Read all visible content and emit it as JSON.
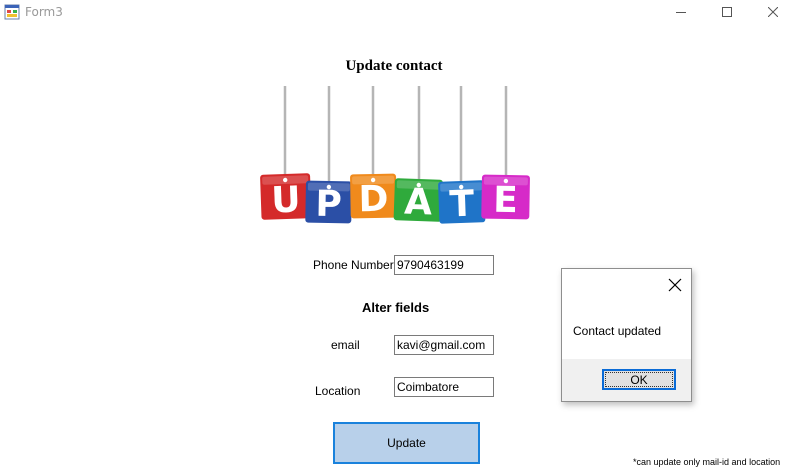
{
  "window": {
    "title": "Form3"
  },
  "form": {
    "heading": "Update contact",
    "image_letters": [
      "U",
      "P",
      "D",
      "A",
      "T",
      "E"
    ],
    "image_colors": [
      "#d42a2a",
      "#2b4fa6",
      "#f08a1c",
      "#2faa3c",
      "#1f74c8",
      "#d62ac8"
    ],
    "phone_label": "Phone Number",
    "phone_value": "9790463199",
    "alter_heading": "Alter fields",
    "email_label": "email",
    "email_value": "kavi@gmail.com",
    "location_label": "Location",
    "location_value": "Coimbatore",
    "update_button": "Update",
    "footnote": "*can update only mail-id and location"
  },
  "dialog": {
    "message": "Contact updated",
    "ok_label": "OK"
  }
}
